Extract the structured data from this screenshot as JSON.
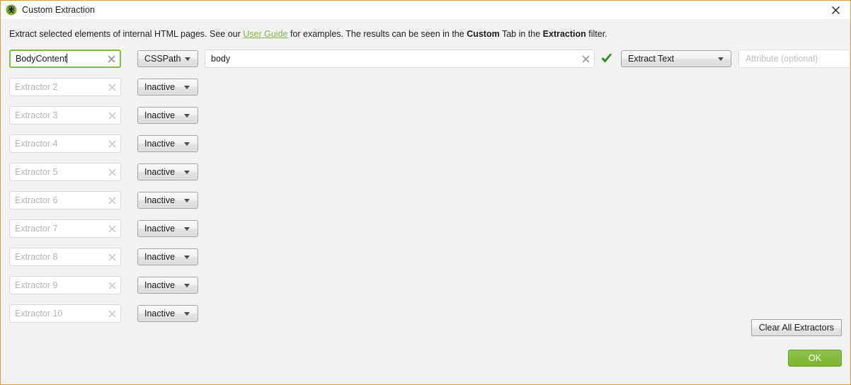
{
  "window": {
    "title": "Custom Extraction",
    "icon": "screaming-frog-logo-icon",
    "close_label": "close-icon",
    "border_color": "#e09a3e"
  },
  "description": {
    "part1": "Extract selected elements of internal HTML pages. See our ",
    "link": "User Guide",
    "part2": " for examples. The results can be seen in the ",
    "bold1": "Custom",
    "part3": " Tab in the ",
    "bold2": "Extraction",
    "part4": " filter.",
    "link_color": "#7eb64a"
  },
  "rows": [
    {
      "name_value": "BodyContent",
      "name_is_placeholder": false,
      "focused": true,
      "type_label": "CSSPath",
      "selector_value": "body",
      "selector_placeholder": "",
      "valid": true,
      "mode_label": "Extract Text",
      "attribute_placeholder": "Attribute (optional)",
      "active": true
    },
    {
      "name_value": "Extractor 2",
      "name_is_placeholder": true,
      "focused": false,
      "type_label": "Inactive",
      "active": false
    },
    {
      "name_value": "Extractor 3",
      "name_is_placeholder": true,
      "focused": false,
      "type_label": "Inactive",
      "active": false
    },
    {
      "name_value": "Extractor 4",
      "name_is_placeholder": true,
      "focused": false,
      "type_label": "Inactive",
      "active": false
    },
    {
      "name_value": "Extractor 5",
      "name_is_placeholder": true,
      "focused": false,
      "type_label": "Inactive",
      "active": false
    },
    {
      "name_value": "Extractor 6",
      "name_is_placeholder": true,
      "focused": false,
      "type_label": "Inactive",
      "active": false
    },
    {
      "name_value": "Extractor 7",
      "name_is_placeholder": true,
      "focused": false,
      "type_label": "Inactive",
      "active": false
    },
    {
      "name_value": "Extractor 8",
      "name_is_placeholder": true,
      "focused": false,
      "type_label": "Inactive",
      "active": false
    },
    {
      "name_value": "Extractor 9",
      "name_is_placeholder": true,
      "focused": false,
      "type_label": "Inactive",
      "active": false
    },
    {
      "name_value": "Extractor 10",
      "name_is_placeholder": true,
      "focused": false,
      "type_label": "Inactive",
      "active": false
    }
  ],
  "footer": {
    "clear_all_label": "Clear All Extractors",
    "ok_label": "OK",
    "ok_color": "#7cb62f"
  }
}
